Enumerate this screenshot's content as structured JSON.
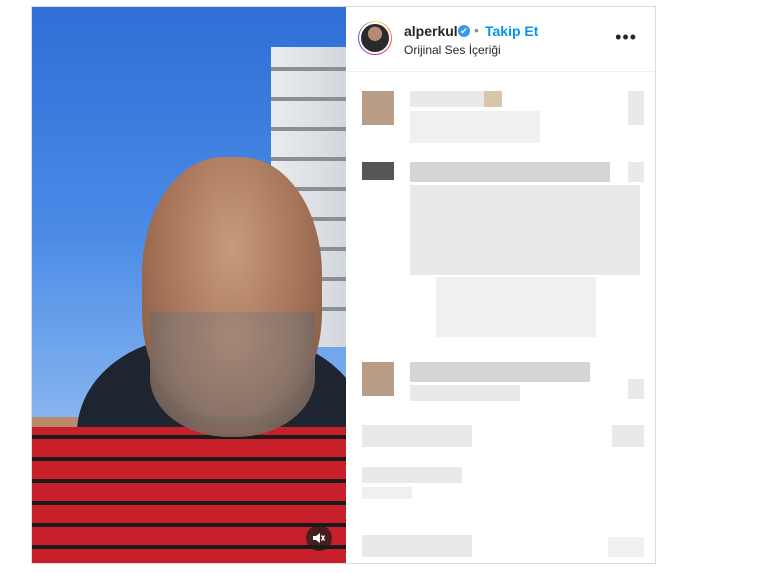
{
  "post": {
    "username": "alperkul",
    "verified_symbol": "✔",
    "separator": "•",
    "follow_label": "Takip Et",
    "audio_label": "Orijinal Ses İçeriği",
    "more_label": "•••"
  },
  "media": {
    "mute_icon": "speaker-muted-icon"
  },
  "colors": {
    "follow": "#0095f6",
    "verified": "#3897f0",
    "text": "#262626"
  }
}
